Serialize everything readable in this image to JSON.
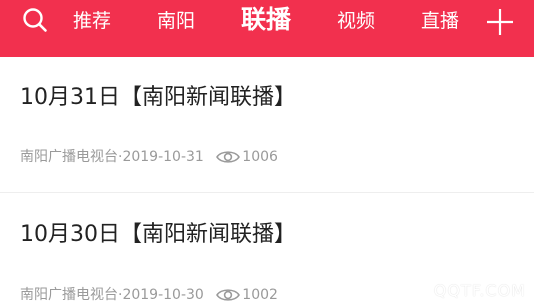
{
  "nav": {
    "tabs": [
      {
        "label": "推荐",
        "active": false
      },
      {
        "label": "南阳",
        "active": false
      },
      {
        "label": "联播",
        "active": true
      },
      {
        "label": "视频",
        "active": false
      },
      {
        "label": "直播",
        "active": false
      }
    ],
    "icons": {
      "search": "search-icon",
      "add": "plus-icon"
    },
    "accent_color": "#f2304e"
  },
  "articles": [
    {
      "title": "10月31日【南阳新闻联播】",
      "source": "南阳广播电视台",
      "date": "2019-10-31",
      "views": "1006"
    },
    {
      "title": "10月30日【南阳新闻联播】",
      "source": "南阳广播电视台",
      "date": "2019-10-30",
      "views": "1002"
    }
  ],
  "watermark": "QQTF.COM"
}
